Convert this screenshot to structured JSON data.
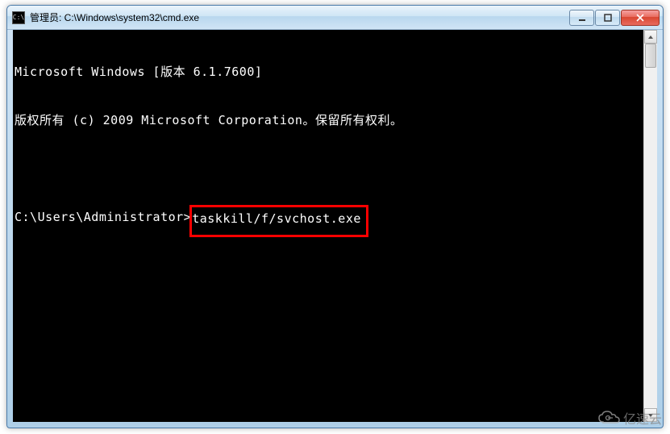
{
  "window": {
    "title": "管理员: C:\\Windows\\system32\\cmd.exe",
    "icon_label": "C:\\"
  },
  "terminal": {
    "line1": "Microsoft Windows [版本 6.1.7600]",
    "line2": "版权所有 (c) 2009 Microsoft Corporation。保留所有权利。",
    "prompt": "C:\\Users\\Administrator>",
    "command": "taskkill/f/svchost.exe"
  },
  "watermark": {
    "text": "亿速云"
  },
  "icons": {
    "minimize": "minimize-icon",
    "maximize": "maximize-icon",
    "close": "close-icon",
    "scroll_up": "scroll-up-icon",
    "scroll_down": "scroll-down-icon"
  }
}
